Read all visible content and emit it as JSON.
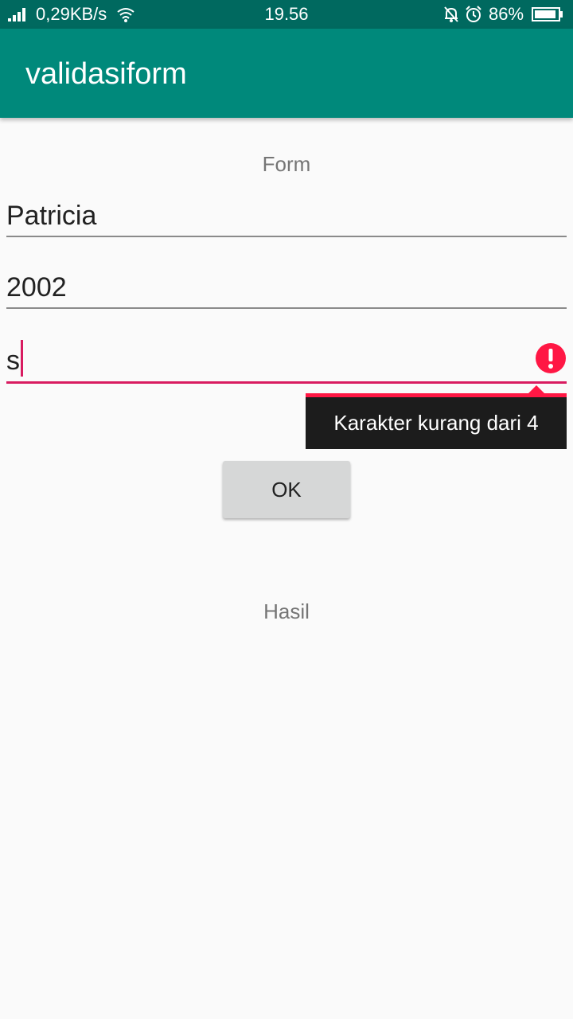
{
  "status_bar": {
    "network_speed": "0,29KB/s",
    "time": "19.56",
    "battery": "86%",
    "icons": [
      "signal-icon",
      "wifi-icon",
      "bell-muted-icon",
      "alarm-icon",
      "battery-icon"
    ]
  },
  "app_bar": {
    "title": "validasiform"
  },
  "form": {
    "label": "Form",
    "name_value": "Patricia",
    "year_value": "2002",
    "code_value": "s",
    "error_message": "Karakter kurang dari 4",
    "submit_label": "OK"
  },
  "result": {
    "label": "Hasil"
  },
  "colors": {
    "status_bar": "#00695f",
    "app_bar": "#00897b",
    "accent": "#d81b60",
    "error": "#ff1744",
    "background": "#fafafa"
  }
}
